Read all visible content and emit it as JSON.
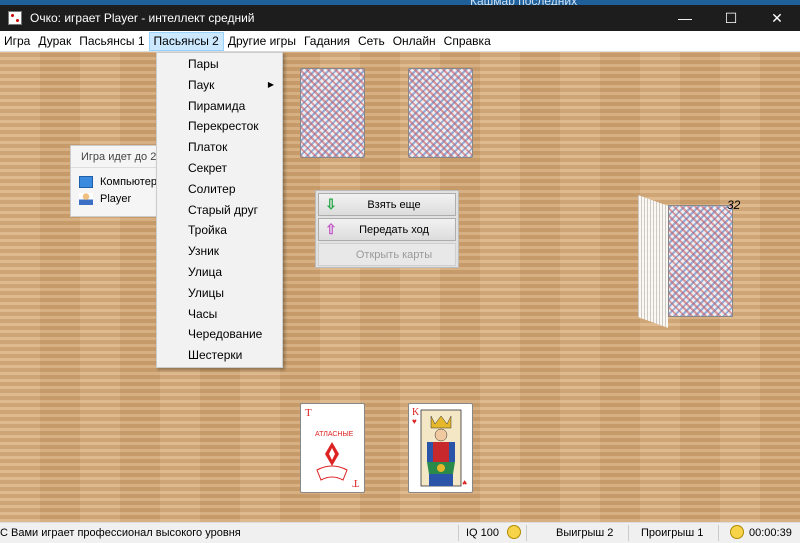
{
  "behind_window": {
    "text": "Кашмар последних"
  },
  "window": {
    "title": "Очко: играет Player - интеллект средний",
    "controls": [
      "—",
      "☐",
      "✕"
    ]
  },
  "menu": {
    "items": [
      "Игра",
      "Дурак",
      "Пасьянсы 1",
      "Пасьянсы 2",
      "Другие игры",
      "Гадания",
      "Сеть",
      "Онлайн",
      "Справка"
    ],
    "active": "Пасьянсы 2"
  },
  "dropdown": {
    "items": [
      "Пары",
      "Паук",
      "Пирамида",
      "Перекресток",
      "Платок",
      "Секрет",
      "Солитер",
      "Старый друг",
      "Тройка",
      "Узник",
      "Улица",
      "Улицы",
      "Часы",
      "Чередование",
      "Шестерки"
    ],
    "submenu_item": "Паук",
    "submenu_arrow": "▶"
  },
  "players_panel": {
    "header": "Игра идет до 2",
    "players": [
      "Компьютер",
      "Player"
    ]
  },
  "actions": {
    "take_more": "Взять еще",
    "pass_turn": "Передать ход",
    "open_cards": "Открыть карты"
  },
  "deck": {
    "count": "32"
  },
  "cards": {
    "player_cards": [
      "Туз ♦",
      "Король ♥"
    ]
  },
  "status": {
    "message": "С Вами играет профессионал высокого уровня",
    "iq": "IQ 100",
    "wins": "Выигрыш 2",
    "losses": "Проигрыш 1",
    "timer": "00:00:39"
  },
  "colors": {
    "table": "#d4a977",
    "titlebar": "#1d1d1d",
    "menu_active": "#cce8ff",
    "suit_red": "#d22"
  }
}
